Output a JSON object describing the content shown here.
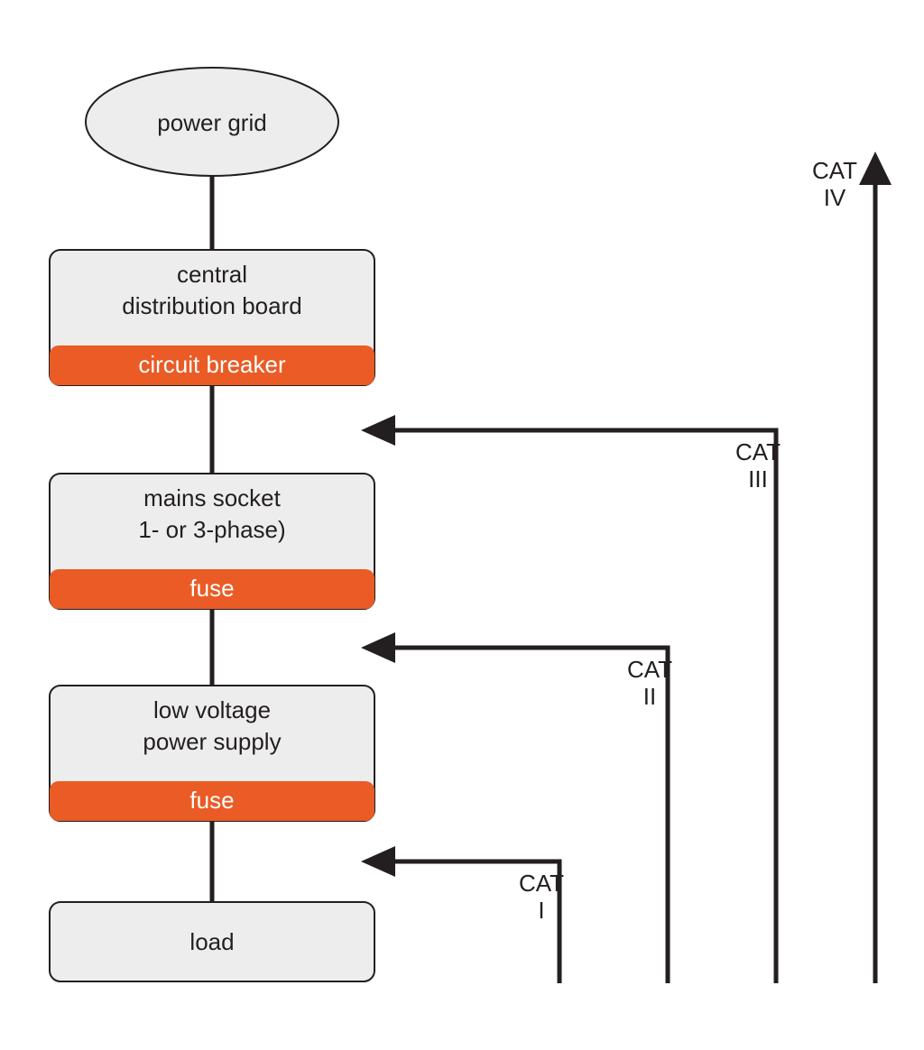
{
  "diagram": {
    "nodes": {
      "power_grid": {
        "label": "power grid"
      },
      "central": {
        "line1": "central",
        "line2": "distribution board",
        "protection": "circuit breaker"
      },
      "mains": {
        "line1": "mains socket",
        "line2": "1- or 3-phase)",
        "protection": "fuse"
      },
      "lv": {
        "line1": "low voltage",
        "line2": "power supply",
        "protection": "fuse"
      },
      "load": {
        "label": "load"
      }
    },
    "categories": {
      "cat1": {
        "line1": "CAT",
        "line2": "I"
      },
      "cat2": {
        "line1": "CAT",
        "line2": "II"
      },
      "cat3": {
        "line1": "CAT",
        "line2": "III"
      },
      "cat4": {
        "line1": "CAT",
        "line2": "IV"
      }
    },
    "colors": {
      "box_fill": "#eeedee",
      "stroke": "#231f20",
      "accent": "#ea5b25"
    }
  }
}
